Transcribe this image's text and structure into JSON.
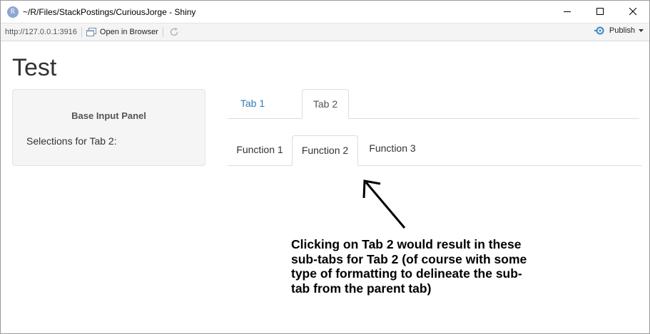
{
  "window": {
    "title": "~/R/Files/StackPostings/CuriousJorge - Shiny",
    "app_icon_letter": "R"
  },
  "toolbar": {
    "url": "http://127.0.0.1:3916",
    "open_in_browser": "Open in Browser",
    "publish": "Publish"
  },
  "page": {
    "title": "Test"
  },
  "panel": {
    "title": "Base Input Panel",
    "text": "Selections for Tab 2:"
  },
  "main_tabs": [
    {
      "label": "Tab 1",
      "active": false
    },
    {
      "label": "Tab 2",
      "active": true
    }
  ],
  "sub_tabs": [
    {
      "label": "Function 1",
      "active": false
    },
    {
      "label": "Function 2",
      "active": true
    },
    {
      "label": "Function 3",
      "active": false
    }
  ],
  "annotation": {
    "text": "Clicking on Tab 2 would result in these sub-tabs for Tab 2 (of course with some type of formatting to delineate the sub-tab from the parent tab)"
  },
  "colors": {
    "tab_link": "#337ab7",
    "panel_bg": "#f5f5f5",
    "border": "#dddddd"
  }
}
